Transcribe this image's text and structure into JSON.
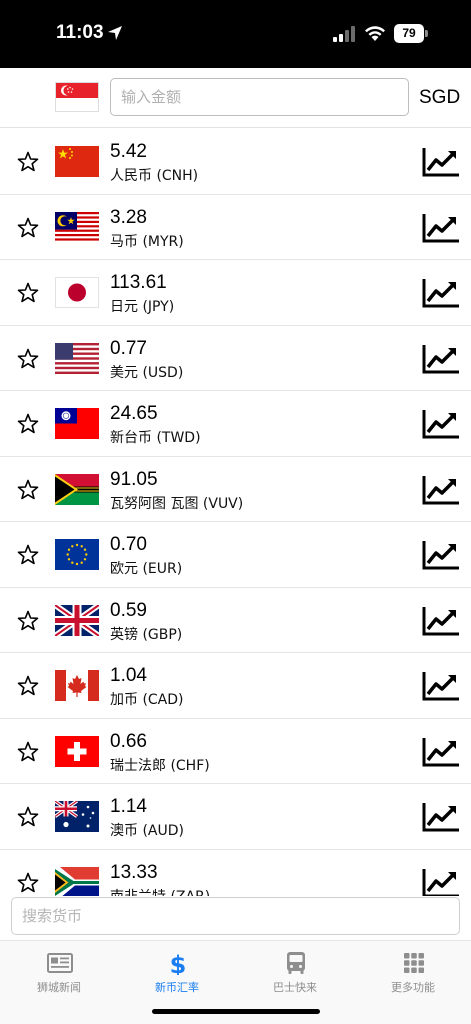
{
  "status_bar": {
    "time": "11:03",
    "battery": "79"
  },
  "converter": {
    "amount_placeholder": "输入金额",
    "base_currency": "SGD"
  },
  "rates": [
    {
      "flag": "cn-flag",
      "value": "5.42",
      "name": "人民币 (CNH)"
    },
    {
      "flag": "my-flag",
      "value": "3.28",
      "name": "马币 (MYR)"
    },
    {
      "flag": "jp-flag",
      "value": "113.61",
      "name": "日元 (JPY)"
    },
    {
      "flag": "us-flag",
      "value": "0.77",
      "name": "美元 (USD)"
    },
    {
      "flag": "tw-flag",
      "value": "24.65",
      "name": "新台币 (TWD)"
    },
    {
      "flag": "vu-flag",
      "value": "91.05",
      "name": "瓦努阿图 瓦图 (VUV)"
    },
    {
      "flag": "eu-flag",
      "value": "0.70",
      "name": "欧元 (EUR)"
    },
    {
      "flag": "gb-flag",
      "value": "0.59",
      "name": "英镑 (GBP)"
    },
    {
      "flag": "ca-flag",
      "value": "1.04",
      "name": "加币 (CAD)"
    },
    {
      "flag": "ch-flag",
      "value": "0.66",
      "name": "瑞士法郎 (CHF)"
    },
    {
      "flag": "au-flag",
      "value": "1.14",
      "name": "澳币 (AUD)"
    },
    {
      "flag": "za-flag",
      "value": "13.33",
      "name": "南非兰特 (ZAR)"
    }
  ],
  "search": {
    "placeholder": "搜索货币"
  },
  "tabs": [
    {
      "label": "狮城新闻",
      "icon": "newspaper-icon",
      "active": false
    },
    {
      "label": "新币汇率",
      "icon": "dollar-icon",
      "active": true
    },
    {
      "label": "巴士快来",
      "icon": "bus-icon",
      "active": false
    },
    {
      "label": "更多功能",
      "icon": "grid-icon",
      "active": false
    }
  ],
  "colors": {
    "accent": "#1a7ef2",
    "inactive": "#8e8e8e"
  }
}
